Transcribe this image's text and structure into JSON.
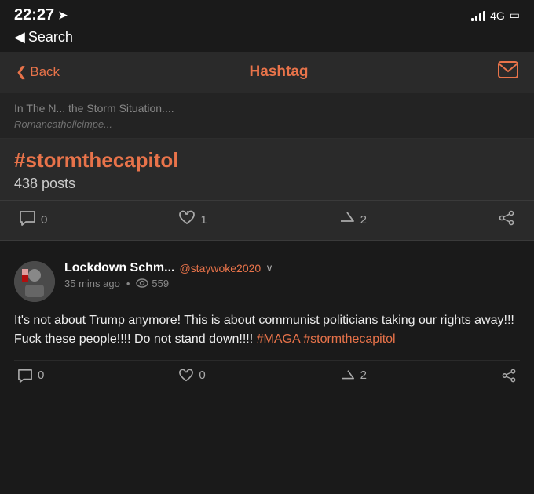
{
  "statusBar": {
    "time": "22:27",
    "arrow": "▶",
    "bars": "signal",
    "network": "4G",
    "battery": "🔋"
  },
  "searchBar": {
    "back_chevron": "◀",
    "label": "Search"
  },
  "navBar": {
    "back_label": "Back",
    "title": "Hashtag",
    "mail_icon": "✉"
  },
  "postPreview": {
    "text": "In The N... the Storm Situation....",
    "user": "Romancatholicimpe..."
  },
  "hashtagSection": {
    "hashtag": "#stormthecapitol",
    "posts_count": "438 posts"
  },
  "actionBar": {
    "comment_count": "0",
    "like_count": "1",
    "upvote_count": "2"
  },
  "post": {
    "avatar_emoji": "🏳",
    "username": "Lockdown Schm...",
    "handle": "@staywoke2020",
    "chevron": "∨",
    "time": "35 mins ago",
    "dot": "•",
    "view_icon": "👁",
    "views": "559",
    "body_before": "It's not about Trump anymore! This is about communist politicians taking our rights away!!! Fuck these people!!!! Do not stand down!!!! ",
    "hashtag1": "#MAGA",
    "body_between": " ",
    "hashtag2": "#stormthecapitol",
    "comment_count": "0",
    "like_count": "0",
    "upvote_count": "2"
  }
}
